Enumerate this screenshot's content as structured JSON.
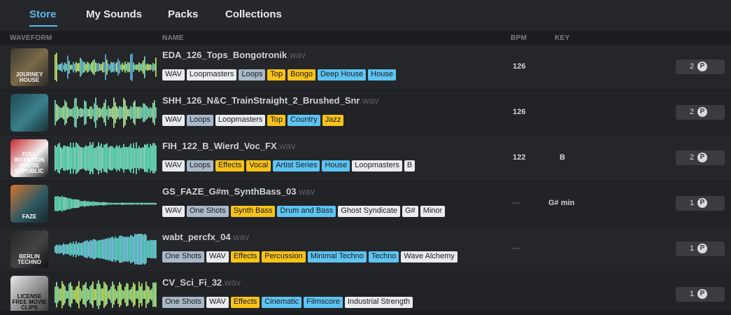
{
  "nav": {
    "tabs": [
      {
        "label": "Store",
        "active": true
      },
      {
        "label": "My Sounds"
      },
      {
        "label": "Packs"
      },
      {
        "label": "Collections"
      }
    ]
  },
  "columns": {
    "waveform": "WAVEFORM",
    "name": "NAME",
    "bpm": "BPM",
    "key": "KEY"
  },
  "colors": {
    "accent": "#5bb8ee",
    "tag_white": "#e9ecee",
    "tag_grey": "#a9b9c8",
    "tag_yellow": "#f7c21a",
    "tag_blue": "#5ec4f2"
  },
  "sounds": [
    {
      "name": "EDA_126_Tops_Bongotronik",
      "ext": ".wav",
      "bpm": "126",
      "key": "",
      "price": "2",
      "price_icon": "P",
      "art": "JOURNEY HOUSE",
      "tags": [
        {
          "label": "WAV",
          "kind": "w"
        },
        {
          "label": "Loopmasters",
          "kind": "w"
        },
        {
          "label": "Loops",
          "kind": "g"
        },
        {
          "label": "Top",
          "kind": "y"
        },
        {
          "label": "Bongo",
          "kind": "y"
        },
        {
          "label": "Deep House",
          "kind": "b"
        },
        {
          "label": "House",
          "kind": "b"
        }
      ]
    },
    {
      "name": "SHH_126_N&C_TrainStraight_2_Brushed_Snr",
      "ext": ".wav",
      "bpm": "126",
      "key": "",
      "price": "2",
      "price_icon": "P",
      "art": "",
      "tags": [
        {
          "label": "WAV",
          "kind": "w"
        },
        {
          "label": "Loops",
          "kind": "g"
        },
        {
          "label": "Loopmasters",
          "kind": "w"
        },
        {
          "label": "Top",
          "kind": "y"
        },
        {
          "label": "Country",
          "kind": "b"
        },
        {
          "label": "Jazz",
          "kind": "y"
        }
      ]
    },
    {
      "name": "FIH_122_B_Wierd_Voc_FX",
      "ext": ".wav",
      "bpm": "122",
      "key": "B",
      "price": "2",
      "price_icon": "P",
      "art": "FULL INTENTION HOUSE REPUBLIC",
      "tags": [
        {
          "label": "WAV",
          "kind": "w"
        },
        {
          "label": "Loops",
          "kind": "g"
        },
        {
          "label": "Effects",
          "kind": "y"
        },
        {
          "label": "Vocal",
          "kind": "y"
        },
        {
          "label": "Artist Series",
          "kind": "b"
        },
        {
          "label": "House",
          "kind": "b"
        },
        {
          "label": "Loopmasters",
          "kind": "w"
        },
        {
          "label": "B",
          "kind": "w"
        }
      ]
    },
    {
      "name": "GS_FAZE_G#m_SynthBass_03",
      "ext": ".wav",
      "bpm": "—",
      "key": "G# min",
      "price": "1",
      "price_icon": "P",
      "art": "FAZE",
      "tags": [
        {
          "label": "WAV",
          "kind": "w"
        },
        {
          "label": "One Shots",
          "kind": "g"
        },
        {
          "label": "Synth Bass",
          "kind": "y"
        },
        {
          "label": "Drum and Bass",
          "kind": "b"
        },
        {
          "label": "Ghost Syndicate",
          "kind": "w"
        },
        {
          "label": "G#",
          "kind": "w"
        },
        {
          "label": "Minor",
          "kind": "w"
        }
      ]
    },
    {
      "name": "wabt_percfx_04",
      "ext": ".wav",
      "bpm": "—",
      "key": "",
      "price": "1",
      "price_icon": "P",
      "art": "BERLIN TECHNO",
      "tags": [
        {
          "label": "One Shots",
          "kind": "g"
        },
        {
          "label": "WAV",
          "kind": "w"
        },
        {
          "label": "Effects",
          "kind": "y"
        },
        {
          "label": "Percussion",
          "kind": "y"
        },
        {
          "label": "Minimal Techno",
          "kind": "b"
        },
        {
          "label": "Techno",
          "kind": "b"
        },
        {
          "label": "Wave Alchemy",
          "kind": "w"
        }
      ]
    },
    {
      "name": "CV_Sci_Fi_32",
      "ext": ".wav",
      "bpm": "",
      "key": "",
      "price": "1",
      "price_icon": "P",
      "art": "LICENSE FREE MOVIE CLIPS",
      "tags": [
        {
          "label": "One Shots",
          "kind": "g"
        },
        {
          "label": "WAV",
          "kind": "w"
        },
        {
          "label": "Effects",
          "kind": "y"
        },
        {
          "label": "Cinematic",
          "kind": "b"
        },
        {
          "label": "Filmscore",
          "kind": "b"
        },
        {
          "label": "Industrial Strength",
          "kind": "w"
        }
      ]
    }
  ]
}
